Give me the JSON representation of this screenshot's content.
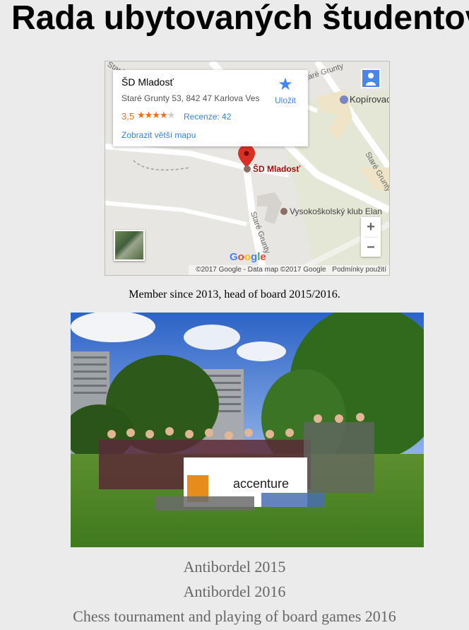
{
  "page": {
    "title": "Rada ubytovaných študentov",
    "caption": "Member since 2013, head of board 2015/2016.",
    "events": [
      "Antibordel 2015",
      "Antibordel 2016",
      "Chess tournament and playing of board games 2016"
    ]
  },
  "map": {
    "place_name": "ŠD Mladosť",
    "address": "Staré Grunty 53, 842 47 Karlova Ves",
    "rating": "3,5",
    "reviews": "Recenze: 42",
    "bigger_map": "Zobrazit větší mapu",
    "save_label": "Uložit",
    "pin_label": "ŠD Mladosť",
    "poi_kopirovac": "Kopírovac",
    "poi_club": "Vysokoškolský klub Elan",
    "street_1": "Staré Grunty",
    "street_2": "Staré Grunty",
    "street_3": "Staré Grunty",
    "street_4": "Staré",
    "zoom_in": "+",
    "zoom_out": "−",
    "google": "Google",
    "copyright": "©2017 Google - Data map ©2017 Google",
    "terms": "Podmínky použití"
  },
  "colors": {
    "background": "#ebebeb",
    "link_blue": "#3a84df",
    "rating_orange": "#e7711b",
    "pin_red": "#d93025",
    "event_text": "#666666"
  }
}
